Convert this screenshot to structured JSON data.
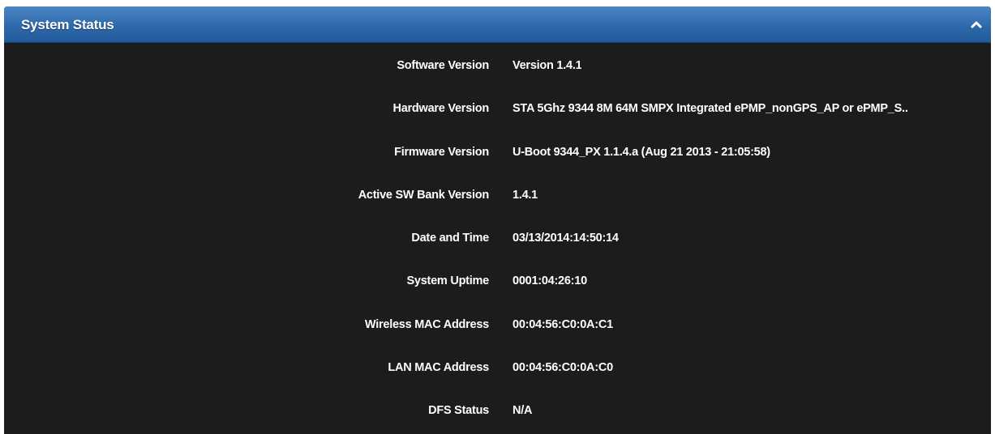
{
  "panel": {
    "title": "System Status",
    "collapse_icon": "chevron-up-icon"
  },
  "rows": [
    {
      "label": "Software Version",
      "value": "Version 1.4.1"
    },
    {
      "label": "Hardware Version",
      "value": "STA 5Ghz 9344 8M 64M SMPX Integrated ePMP_nonGPS_AP or ePMP_S.."
    },
    {
      "label": "Firmware Version",
      "value": "U-Boot 9344_PX 1.1.4.a (Aug 21 2013 - 21:05:58)"
    },
    {
      "label": "Active SW Bank Version",
      "value": "1.4.1"
    },
    {
      "label": "Date and Time",
      "value": "03/13/2014:14:50:14"
    },
    {
      "label": "System Uptime",
      "value": "0001:04:26:10"
    },
    {
      "label": "Wireless MAC Address",
      "value": "00:04:56:C0:0A:C1"
    },
    {
      "label": "LAN MAC Address",
      "value": "00:04:56:C0:0A:C0"
    },
    {
      "label": "DFS Status",
      "value": "N/A"
    }
  ],
  "colors": {
    "header_blue": "#2e69ab",
    "panel_background": "#1c1c1c",
    "text": "#ffffff"
  }
}
